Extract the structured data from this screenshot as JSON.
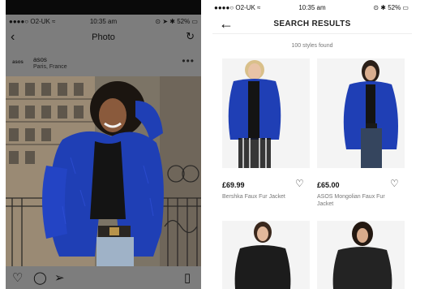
{
  "left_phone": {
    "status": {
      "carrier": "●●●●○ O2-UK ≈",
      "time": "10:35 am",
      "battery": "⊙ ➤ ✱ 52% ▭"
    },
    "nav": {
      "title": "Photo"
    },
    "post": {
      "account": "asos",
      "location": "Paris, France",
      "logo_text": "asos"
    }
  },
  "right_phone": {
    "status": {
      "carrier": "●●●●○ O2-UK ≈",
      "time": "10:35 am",
      "battery": "⊙ ✱ 52% ▭"
    },
    "nav": {
      "title": "SEARCH RESULTS"
    },
    "results_count": "100 styles found",
    "products": [
      {
        "price": "£69.99",
        "name": "Bershka Faux Fur Jacket"
      },
      {
        "price": "£65.00",
        "name": "ASOS Mongolian Faux Fur Jacket"
      }
    ]
  },
  "colors": {
    "jacket_blue": "#1f3fb5",
    "dim_overlay": "#7d7d7d"
  }
}
